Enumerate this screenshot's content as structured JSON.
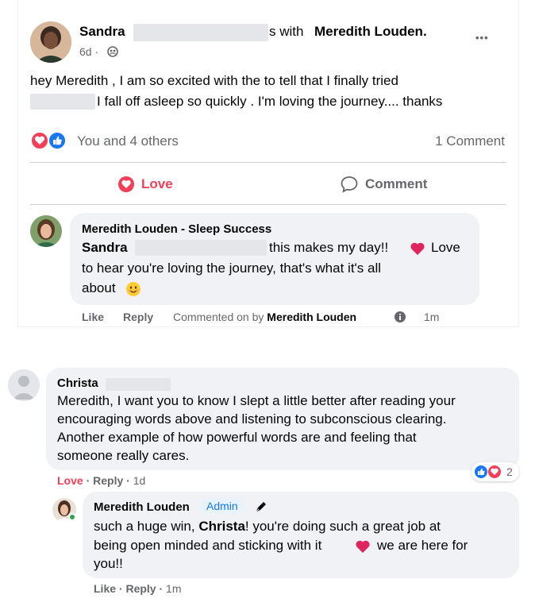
{
  "post": {
    "author_first": "Sandra",
    "with_text": "s with",
    "with_name": "Meredith Louden.",
    "time": "6d",
    "separator": "·",
    "more": "•••",
    "body_line1": "hey Meredith , I am so excited with the to tell that I finally tried",
    "body_line2": "I fall off asleep so quickly . I'm loving the journey.... thanks",
    "reactions_text": "You and 4 others",
    "comments_count": "1 Comment",
    "love_label": "Love",
    "comment_label": "Comment"
  },
  "reply1": {
    "author": "Meredith Louden - Sleep Success",
    "mention": "Sandra",
    "text_a": "this makes my day!!",
    "text_b": "Love",
    "line2": "to hear you're loving the journey, that's what it's all",
    "line3": "about",
    "like": "Like",
    "reply": "Reply",
    "commented_by": "Commented on by",
    "commented_name": "Meredith Louden",
    "time": "1m"
  },
  "comment2": {
    "author": "Christa",
    "line1": "Meredith, I want you to know I slept a little better after reading your",
    "line2": "encouraging words above and listening to subconscious clearing.",
    "line3": "Another example of how powerful words are and feeling that",
    "line4": "someone really cares.",
    "love": "Love",
    "dot": "·",
    "reply": "Reply",
    "time": "1d",
    "reaction_count": "2"
  },
  "reply2": {
    "author": "Meredith Louden",
    "badge": "Admin",
    "line1": "such a huge win,",
    "mention": "Christa",
    "line1b": "! you're doing such a great job at",
    "line2a": "being open minded and sticking with it",
    "line2b": "we are here for",
    "line3": "you!!",
    "like": "Like",
    "dot": "·",
    "reply": "Reply",
    "time": "1m"
  },
  "colors": {
    "love_red": "#f33e58",
    "fb_blue": "#1877f2",
    "muted": "#65676b",
    "bubble": "#f0f2f5"
  }
}
